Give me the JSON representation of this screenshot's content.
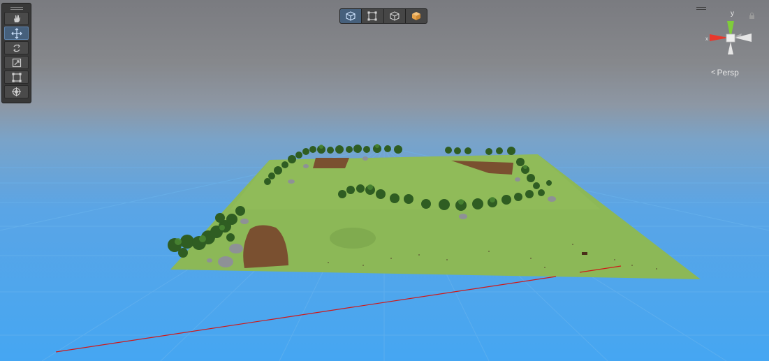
{
  "app": {
    "window": "Scene View"
  },
  "tools": [
    {
      "name": "hand-tool",
      "icon": "hand-icon",
      "active": false
    },
    {
      "name": "move-tool",
      "icon": "move-icon",
      "active": true
    },
    {
      "name": "rotate-tool",
      "icon": "rotate-icon",
      "active": false
    },
    {
      "name": "scale-tool",
      "icon": "scale-icon",
      "active": false
    },
    {
      "name": "rect-tool",
      "icon": "rect-transform-icon",
      "active": false
    },
    {
      "name": "transform-tool",
      "icon": "transform-icon",
      "active": false
    }
  ],
  "draw_modes": [
    {
      "name": "shaded-mode",
      "icon": "cube-icon",
      "active": true
    },
    {
      "name": "rect-mode",
      "icon": "rect-icon",
      "active": false
    },
    {
      "name": "wireframe-mode",
      "icon": "wire-cube-icon",
      "active": false
    },
    {
      "name": "lit-mode",
      "icon": "lit-cube-icon",
      "active": false
    }
  ],
  "gizmo": {
    "axis_y_label": "y",
    "axis_x_label": "x",
    "projection_label": "Persp",
    "x_color": "#e8382c",
    "y_color": "#7fcc3a",
    "z_color": "#e6e6e6"
  },
  "scene": {
    "sky_color": "#86888c",
    "ground_color": "#45a6f2",
    "terrain_color": "#8cb857",
    "dirt_color": "#7a5030",
    "tree_color": "#2f5d22"
  }
}
